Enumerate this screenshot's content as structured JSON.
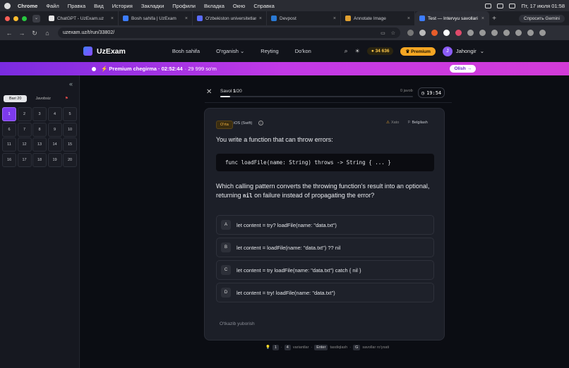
{
  "menubar": {
    "app": "Chrome",
    "items": [
      "Файл",
      "Правка",
      "Вид",
      "История",
      "Закладки",
      "Профили",
      "Вкладка",
      "Окно",
      "Справка"
    ],
    "clock": "Пт, 17 июля  01:58"
  },
  "browser": {
    "tabs": [
      {
        "label": "ChatGPT - UzExam.uz",
        "color": "#e6e6e6"
      },
      {
        "label": "Bosh sahifa | UzExam",
        "color": "#3d7dff"
      },
      {
        "label": "O'zbekiston universitetlari",
        "color": "#5a6cff"
      },
      {
        "label": "Devpost",
        "color": "#2a7ad4"
      },
      {
        "label": "Annotate Image",
        "color": "#e0a030"
      },
      {
        "label": "Test — Intervyu savollari",
        "color": "#3d7dff"
      }
    ],
    "gemini": "Спросить Gemini",
    "url": "uzexam.uz/t/run/33802/"
  },
  "header": {
    "logo": "UzExam",
    "nav": [
      "Bosh sahifa",
      "O'rganish ⌄",
      "Reyting",
      "Do'kon"
    ],
    "coins": "34 636",
    "premium": "Premium",
    "user_initial": "J",
    "user": "Jahongir"
  },
  "promo": {
    "title": "⚡ Premium chegirma · 02:52:44",
    "rest": "· 29 999 so'm",
    "button": "Olish →"
  },
  "sidebar": {
    "filters": [
      "Bari 20",
      "Javobsiz"
    ],
    "questions": [
      "1",
      "2",
      "3",
      "4",
      "5",
      "6",
      "7",
      "8",
      "9",
      "10",
      "11",
      "12",
      "13",
      "14",
      "15",
      "16",
      "17",
      "18",
      "19",
      "20"
    ],
    "current": 1
  },
  "quiz": {
    "savol_prefix": "Savol ",
    "savol_num": "1",
    "savol_total": "/20",
    "answered": "0 javob",
    "progress": 0.05,
    "timer": "19:54",
    "difficulty": "O'rta",
    "category": "iOS (Swift)",
    "error_label": "Xato",
    "bookmark": "Belgilash",
    "question_intro": "You write a function that can throw errors:",
    "code": "func loadFile(name: String) throws -> String { ... }",
    "question_a": "Which calling pattern converts the throwing function's result into an optional, returning",
    "question_code": "nil",
    "question_b": "on failure instead of propagating the error?",
    "options": [
      {
        "letter": "A",
        "text": "let content = try? loadFile(name: \"data.txt\")"
      },
      {
        "letter": "B",
        "text": "let content = loadFile(name: \"data.txt\") ?? nil"
      },
      {
        "letter": "C",
        "text": "let content = try loadFile(name: \"data.txt\") catch { nil }"
      },
      {
        "letter": "D",
        "text": "let content = try! loadFile(name: \"data.txt\")"
      }
    ],
    "skip": "O'tkazib yuborish",
    "hint": {
      "k1": "1",
      "k2": "4",
      "t1": "variantlar",
      "k3": "Enter",
      "t2": "tasdiqlash",
      "k4": "G",
      "t3": "savollar ro'yxati"
    }
  }
}
